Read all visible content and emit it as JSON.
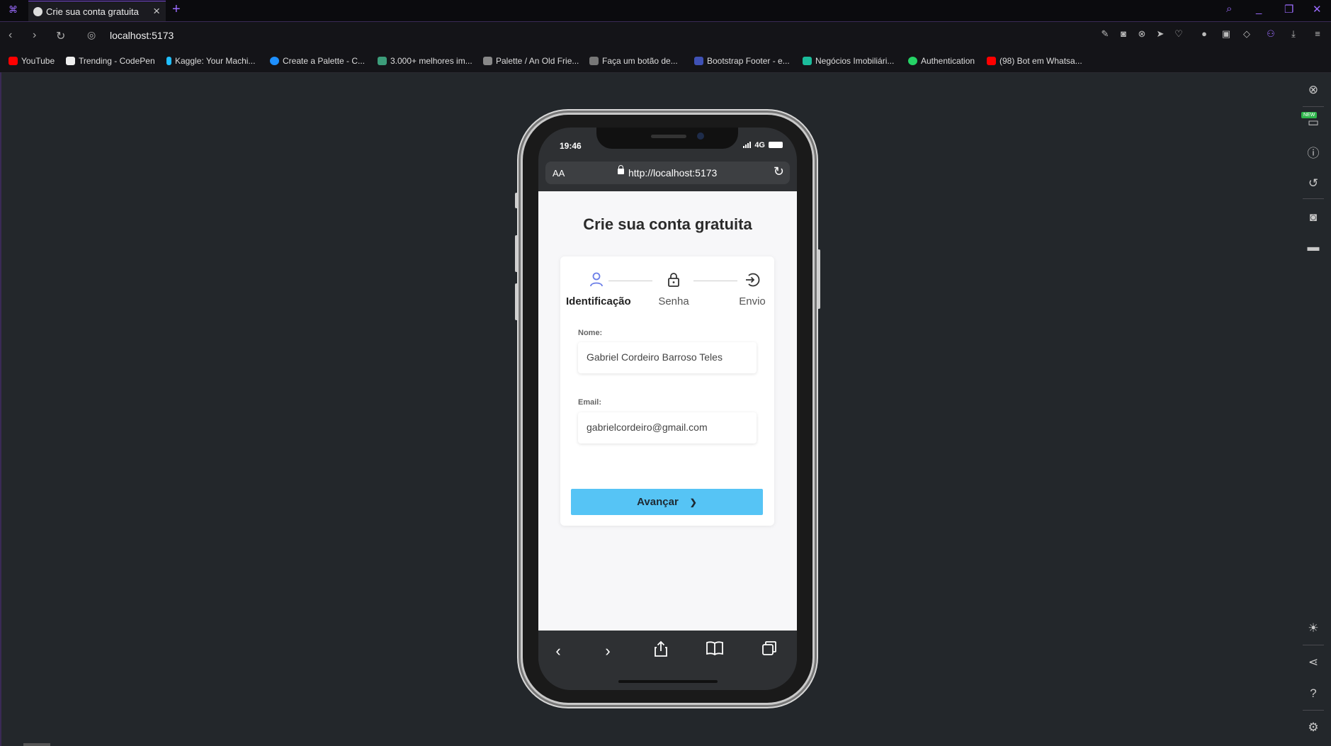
{
  "browser": {
    "tab_title": "Crie sua conta gratuita",
    "url": "localhost:5173",
    "bookmarks": [
      {
        "label": "YouTube",
        "color": "#ff0000"
      },
      {
        "label": "Trending - CodePen",
        "color": "#eeeeee"
      },
      {
        "label": "Kaggle: Your Machi...",
        "color": "#20beff"
      },
      {
        "label": "Create a Palette - C...",
        "color": "#1e90ff"
      },
      {
        "label": "3.000+ melhores im...",
        "color": "#3c9d7a"
      },
      {
        "label": "Palette / An Old Frie...",
        "color": "#888888"
      },
      {
        "label": "Faça um botão de...",
        "color": "#777777"
      },
      {
        "label": "Bootstrap Footer - e...",
        "color": "#3f51b5"
      },
      {
        "label": "Negócios Imobiliári...",
        "color": "#1bbc9b"
      },
      {
        "label": "Authentication",
        "color": "#25d366"
      },
      {
        "label": "(98) Bot em Whatsa...",
        "color": "#ff0000"
      }
    ]
  },
  "phone": {
    "time": "19:46",
    "network": "4G",
    "safari_aa": "AA",
    "safari_url": "http://localhost:5173"
  },
  "form": {
    "title": "Crie sua conta gratuita",
    "steps": [
      {
        "label": "Identificação",
        "icon": "user-icon",
        "active": true
      },
      {
        "label": "Senha",
        "icon": "lock-icon",
        "active": false
      },
      {
        "label": "Envio",
        "icon": "sign-in-icon",
        "active": false
      }
    ],
    "name_label": "Nome:",
    "name_value": "Gabriel Cordeiro Barroso Teles",
    "email_label": "Email:",
    "email_value": "gabrielcordeiro@gmail.com",
    "submit_label": "Avançar",
    "accent_color": "#56c4f5",
    "active_step_color": "#6b7ee8"
  }
}
